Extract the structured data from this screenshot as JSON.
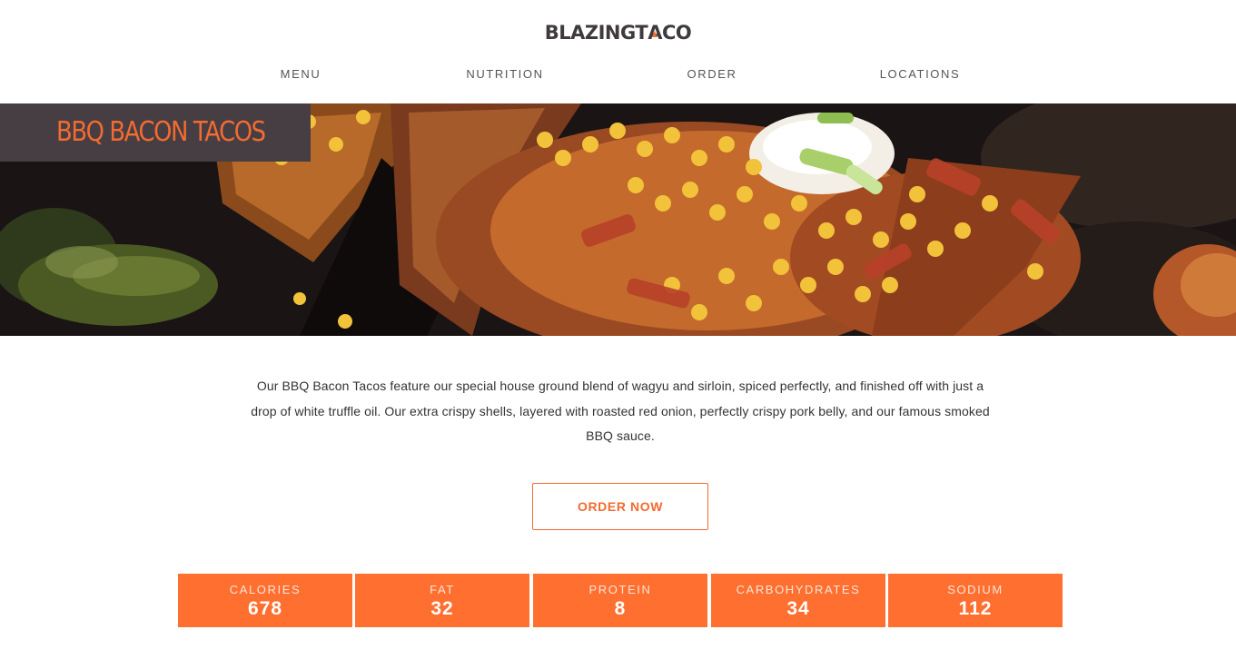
{
  "brand": {
    "logo_prefix": "BLAZINGT",
    "logo_a": "A",
    "logo_suffix": "CO"
  },
  "nav": {
    "items": [
      {
        "label": "MENU"
      },
      {
        "label": "NUTRITION"
      },
      {
        "label": "ORDER"
      },
      {
        "label": "LOCATIONS"
      }
    ]
  },
  "hero": {
    "title": "BBQ BACON TACOS"
  },
  "description": "Our BBQ Bacon Tacos feature our special house ground blend of wagyu and sirloin, spiced perfectly, and finished off with just a drop of white truffle oil. Our extra crispy shells, layered with roasted red onion, perfectly crispy pork belly, and our famous smoked BBQ sauce.",
  "cta": {
    "label": "ORDER NOW"
  },
  "nutrition": [
    {
      "label": "CALORIES",
      "value": "678"
    },
    {
      "label": "FAT",
      "value": "32"
    },
    {
      "label": "PROTEIN",
      "value": "8"
    },
    {
      "label": "CARBOHYDRATES",
      "value": "34"
    },
    {
      "label": "SODIUM",
      "value": "112"
    }
  ],
  "colors": {
    "accent": "#f26b30",
    "stat_bg": "#ff6f30",
    "title_box": "#463e43",
    "logo": "#3f3a3e"
  }
}
